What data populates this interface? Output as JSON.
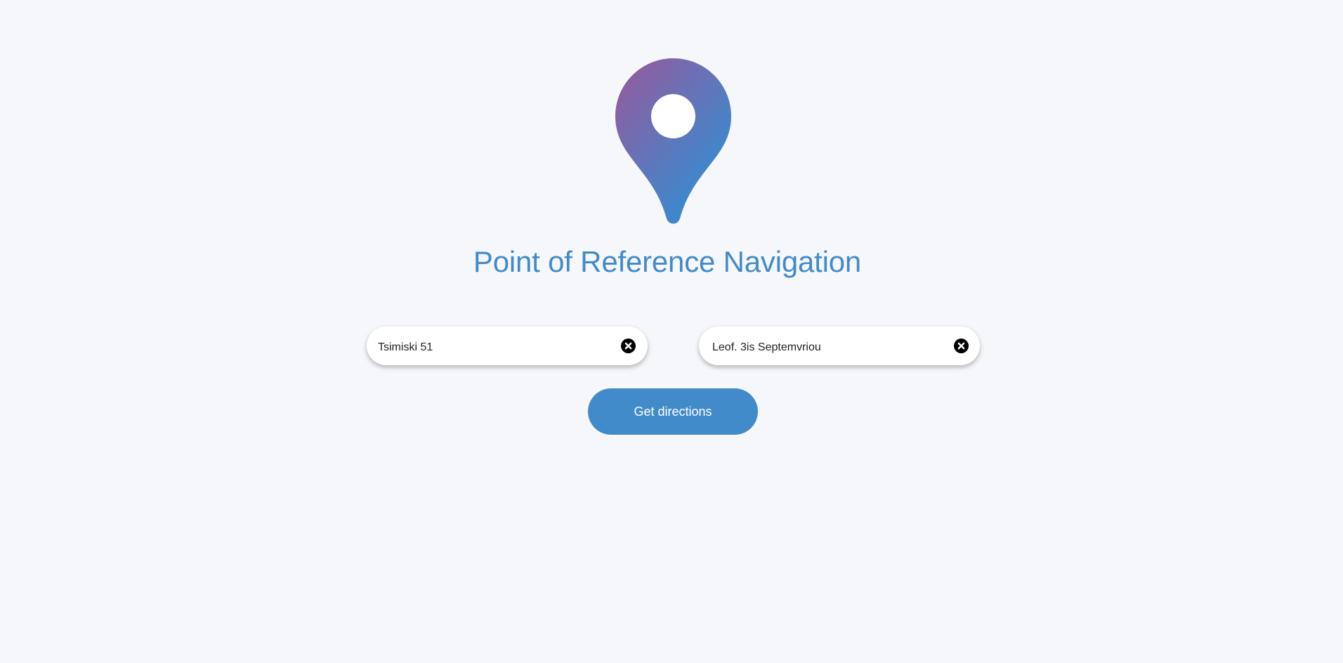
{
  "logo": {
    "icon": "map-pin-icon",
    "gradient_start": "#8e5ea2",
    "gradient_end": "#3f87cc"
  },
  "header": {
    "title": "Point of Reference Navigation"
  },
  "form": {
    "origin": {
      "value": "Tsimiski 51",
      "clear_icon": "close-circle-icon"
    },
    "destination": {
      "value": "Leof. 3is Septemvriou",
      "clear_icon": "close-circle-icon"
    },
    "submit_label": "Get directions"
  },
  "colors": {
    "accent": "#428bca",
    "background": "#f5f7fa"
  }
}
